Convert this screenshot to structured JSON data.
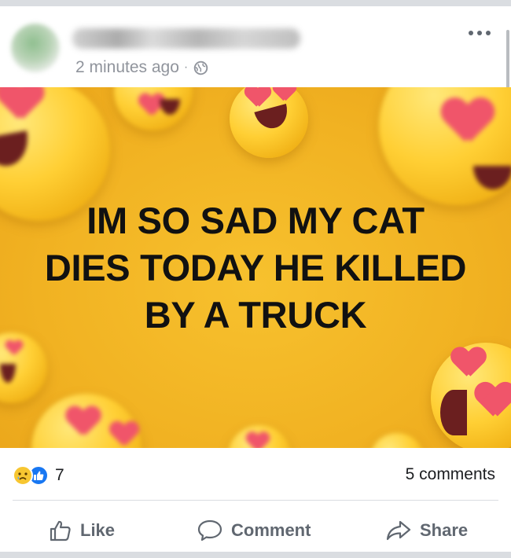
{
  "post": {
    "timestamp": "2 minutes ago",
    "separator": "·",
    "privacy_icon": "globe-icon",
    "more_icon": "more-options-icon"
  },
  "image": {
    "caption_lines": [
      "IM SO SAD MY CAT",
      "DIES TODAY HE KILLED",
      "BY A TRUCK"
    ],
    "background_color": "#f1b222"
  },
  "engagement": {
    "reaction_icons": [
      "sad-reaction-icon",
      "like-reaction-icon"
    ],
    "reaction_count": "7",
    "comments": "5 comments"
  },
  "actions": {
    "like": "Like",
    "comment": "Comment",
    "share": "Share"
  },
  "colors": {
    "like_blue": "#1877f2",
    "action_gray": "#606770",
    "heart_pink": "#f0556a"
  }
}
